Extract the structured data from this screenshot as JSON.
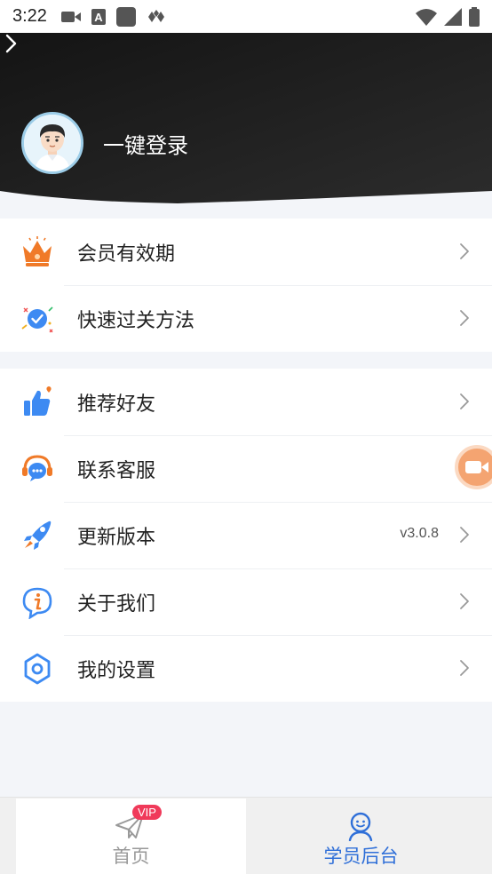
{
  "status_bar": {
    "time": "3:22",
    "left_icons": [
      "video-icon",
      "a-icon",
      "app-square-icon",
      "diamond-icon"
    ],
    "right_icons": [
      "wifi-icon",
      "signal-icon",
      "battery-icon"
    ]
  },
  "header": {
    "background_color": "#1e1e1e",
    "login_text": "一键登录"
  },
  "menu_group_1": [
    {
      "name": "membership-validity",
      "label": "会员有效期",
      "icon": "crown-icon"
    },
    {
      "name": "quick-pass-method",
      "label": "快速过关方法",
      "icon": "check-badge-icon"
    }
  ],
  "menu_group_2": [
    {
      "name": "recommend-friend",
      "label": "推荐好友",
      "icon": "thumbs-up-icon"
    },
    {
      "name": "contact-service",
      "label": "联系客服",
      "icon": "headset-icon"
    },
    {
      "name": "update-version",
      "label": "更新版本",
      "icon": "rocket-icon",
      "value": "v3.0.8"
    },
    {
      "name": "about-us",
      "label": "关于我们",
      "icon": "info-icon"
    },
    {
      "name": "my-settings",
      "label": "我的设置",
      "icon": "gear-icon"
    }
  ],
  "tab_bar": {
    "tabs": [
      {
        "name": "home",
        "label": "首页",
        "badge": "VIP",
        "icon": "paper-plane-icon",
        "active": false
      },
      {
        "name": "student-center",
        "label": "学员后台",
        "icon": "student-icon",
        "active": true
      }
    ],
    "active_color": "#2f6fd8",
    "inactive_color": "#999999"
  },
  "colors": {
    "accent_blue": "#2f6fd8",
    "accent_orange": "#f07a28",
    "icon_blue": "#3d8af2"
  }
}
